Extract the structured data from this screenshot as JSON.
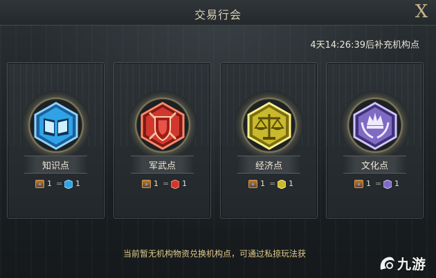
{
  "window": {
    "title": "交易行会",
    "close_icon": "X"
  },
  "timer_text": "4天14:26:39后补充机构点",
  "cards": [
    {
      "label": "知识点",
      "badge_icon": "book-icon",
      "color": "#2fa3e6",
      "cost": "1",
      "gain": "1"
    },
    {
      "label": "军武点",
      "badge_icon": "shield-swords-icon",
      "color": "#d2372d",
      "cost": "1",
      "gain": "1"
    },
    {
      "label": "经济点",
      "badge_icon": "scales-icon",
      "color": "#c9b92c",
      "cost": "1",
      "gain": "1"
    },
    {
      "label": "文化点",
      "badge_icon": "crown-laurel-icon",
      "color": "#7f6bc4",
      "cost": "1",
      "gain": "1"
    }
  ],
  "footer_text": "当前暂无机构物资兑换机构点，可通过私掠玩法获",
  "watermark": {
    "icon": "jiuyou-logo-icon",
    "text": "九游"
  }
}
